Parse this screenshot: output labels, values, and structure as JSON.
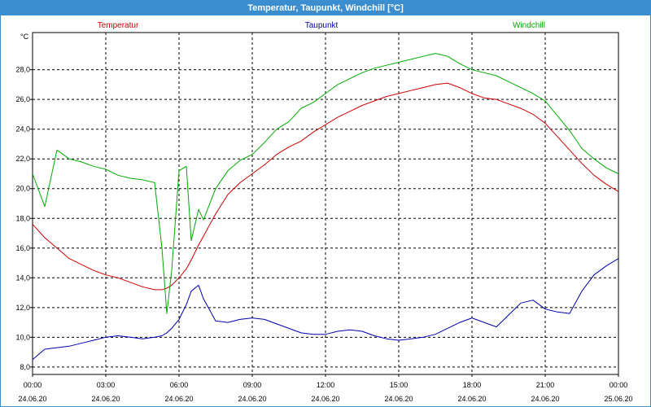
{
  "window": {
    "title": "Temperatur, Taupunkt, Windchill [°C]"
  },
  "chart_data": {
    "type": "line",
    "title": "Temperatur, Taupunkt, Windchill [°C]",
    "ylabel": "°C",
    "ylim": [
      7.5,
      30.5
    ],
    "xlim_hours": [
      0,
      24
    ],
    "grid": true,
    "legend": "top",
    "y_ticks": [
      "8,0",
      "10,0",
      "12,0",
      "14,0",
      "16,0",
      "18,0",
      "20,0",
      "22,0",
      "24,0",
      "26,0",
      "28,0"
    ],
    "x_ticks": [
      {
        "time": "00:00",
        "date": "24.06.20"
      },
      {
        "time": "03:00",
        "date": "24.06.20"
      },
      {
        "time": "06:00",
        "date": "24.06.20"
      },
      {
        "time": "09:00",
        "date": "24.06.20"
      },
      {
        "time": "12:00",
        "date": "24.06.20"
      },
      {
        "time": "15:00",
        "date": "24.06.20"
      },
      {
        "time": "18:00",
        "date": "24.06.20"
      },
      {
        "time": "21:00",
        "date": "24.06.20"
      },
      {
        "time": "00:00",
        "date": "25.06.20"
      }
    ],
    "x": [
      0,
      0.5,
      1,
      1.5,
      2,
      2.5,
      3,
      3.5,
      4,
      4.5,
      5,
      5.3,
      5.5,
      5.7,
      6,
      6.3,
      6.5,
      6.8,
      7,
      7.5,
      8,
      8.5,
      9,
      9.5,
      10,
      10.5,
      11,
      11.5,
      12,
      12.5,
      13,
      13.5,
      14,
      14.5,
      15,
      15.5,
      16,
      16.5,
      17,
      17.5,
      18,
      18.5,
      19,
      19.5,
      20,
      20.5,
      21,
      21.5,
      22,
      22.5,
      23,
      23.5,
      24
    ],
    "series": [
      {
        "name": "Temperatur",
        "color": "#cc0000",
        "values": [
          17.6,
          16.7,
          16.0,
          15.3,
          14.9,
          14.5,
          14.2,
          14.0,
          13.7,
          13.4,
          13.2,
          13.2,
          13.3,
          13.5,
          14.0,
          14.6,
          15.2,
          16.2,
          16.8,
          18.3,
          19.6,
          20.4,
          21.0,
          21.6,
          22.3,
          22.8,
          23.2,
          23.8,
          24.3,
          24.8,
          25.2,
          25.6,
          25.9,
          26.2,
          26.4,
          26.6,
          26.8,
          27.0,
          27.1,
          26.8,
          26.4,
          26.1,
          26.0,
          25.7,
          25.4,
          25.0,
          24.4,
          23.5,
          22.6,
          21.7,
          20.9,
          20.3,
          19.8
        ]
      },
      {
        "name": "Taupunkt",
        "color": "#0000aa",
        "values": [
          8.5,
          9.2,
          9.3,
          9.4,
          9.6,
          9.8,
          10.0,
          10.1,
          10.0,
          9.9,
          10.0,
          10.1,
          10.3,
          10.6,
          11.2,
          12.2,
          13.1,
          13.5,
          12.6,
          11.1,
          11.0,
          11.2,
          11.3,
          11.2,
          10.9,
          10.6,
          10.3,
          10.2,
          10.2,
          10.4,
          10.5,
          10.4,
          10.1,
          9.9,
          9.8,
          9.9,
          10.0,
          10.2,
          10.6,
          11.0,
          11.3,
          11.0,
          10.7,
          11.5,
          12.3,
          12.5,
          11.9,
          11.7,
          11.6,
          13.1,
          14.2,
          14.8,
          15.3
        ]
      },
      {
        "name": "Windchill",
        "color": "#00aa00",
        "values": [
          21.0,
          18.8,
          22.6,
          22.0,
          21.8,
          21.5,
          21.3,
          20.9,
          20.7,
          20.6,
          20.4,
          16.0,
          11.6,
          14.5,
          21.2,
          21.5,
          16.5,
          18.6,
          17.9,
          20.0,
          21.2,
          21.9,
          22.3,
          23.1,
          24.0,
          24.5,
          25.4,
          25.8,
          26.4,
          27.0,
          27.4,
          27.8,
          28.1,
          28.3,
          28.5,
          28.7,
          28.9,
          29.1,
          28.9,
          28.4,
          28.0,
          27.8,
          27.6,
          27.2,
          26.8,
          26.4,
          25.9,
          24.9,
          23.9,
          22.7,
          22.0,
          21.4,
          21.0
        ]
      }
    ]
  }
}
